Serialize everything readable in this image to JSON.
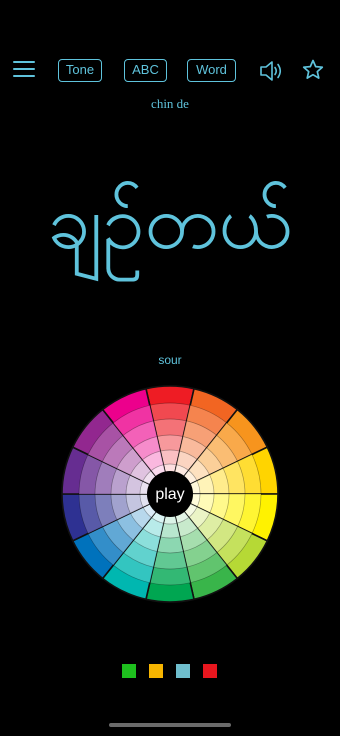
{
  "toolbar": {
    "menu_icon": "hamburger-menu-icon",
    "tone_label": "Tone",
    "abc_label": "ABC",
    "word_label": "Word",
    "speaker_icon": "speaker-icon",
    "star_icon": "star-outline-icon"
  },
  "word": {
    "romanization": "chin de",
    "burmese": "ချဉ်တယ်",
    "tone": "sour"
  },
  "wheel": {
    "center_label": "play",
    "segment_colors": [
      "#ee1c24",
      "#f26522",
      "#f7941d",
      "#ffd400",
      "#fff200",
      "#b6d935",
      "#39b54a",
      "#00a651",
      "#00b7b0",
      "#0072bc",
      "#2e3192",
      "#662d91",
      "#92278f",
      "#ec008c"
    ]
  },
  "swatches": {
    "colors": [
      "#1ec01e",
      "#f7b500",
      "#6fbecd",
      "#e8161e"
    ]
  },
  "colors": {
    "accent": "#5fc3dc",
    "background": "#000000"
  }
}
